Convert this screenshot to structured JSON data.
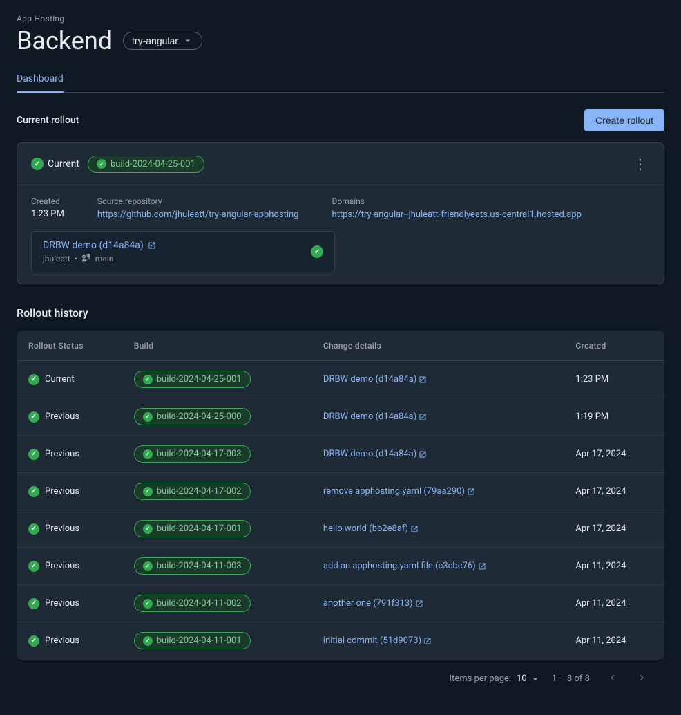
{
  "page": {
    "app_hosting_label": "App Hosting",
    "backend_title": "Backend",
    "branch_selector": "try-angular",
    "tab_dashboard": "Dashboard",
    "create_rollout_label": "Create rollout",
    "current_rollout_label": "Current rollout",
    "rollout_history_label": "Rollout history"
  },
  "current_rollout": {
    "status_label": "Current",
    "build_badge": "build-2024-04-25-001",
    "created_label": "Created",
    "created_value": "1:23 PM",
    "source_repo_label": "Source repository",
    "source_repo_url": "https://github.com/jhuleatt/try-angular-apphosting",
    "source_repo_display": "https://github.com/jhuleatt/try-angular-apphosting",
    "domains_label": "Domains",
    "domains_url": "https://try-angular--jhuleatt-friendlyeats.us-central1.hosted.app",
    "domains_display": "https://try-angular--jhuleatt-friendlyeats.us-central1.hosted.app",
    "commit_link_text": "DRBW demo (d14a84a)",
    "commit_user": "jhuleatt",
    "commit_branch": "main"
  },
  "table": {
    "col_status": "Rollout Status",
    "col_build": "Build",
    "col_change": "Change details",
    "col_created": "Created",
    "rows": [
      {
        "status": "Current",
        "build": "build-2024-04-25-001",
        "change": "DRBW demo (d14a84a)",
        "created": "1:23 PM"
      },
      {
        "status": "Previous",
        "build": "build-2024-04-25-000",
        "change": "DRBW demo (d14a84a)",
        "created": "1:19 PM"
      },
      {
        "status": "Previous",
        "build": "build-2024-04-17-003",
        "change": "DRBW demo (d14a84a)",
        "created": "Apr 17, 2024"
      },
      {
        "status": "Previous",
        "build": "build-2024-04-17-002",
        "change": "remove apphosting.yaml (79aa290)",
        "created": "Apr 17, 2024"
      },
      {
        "status": "Previous",
        "build": "build-2024-04-17-001",
        "change": "hello world (bb2e8af)",
        "created": "Apr 17, 2024"
      },
      {
        "status": "Previous",
        "build": "build-2024-04-11-003",
        "change": "add an apphosting.yaml file (c3cbc76)",
        "created": "Apr 11, 2024"
      },
      {
        "status": "Previous",
        "build": "build-2024-04-11-002",
        "change": "another one (791f313)",
        "created": "Apr 11, 2024"
      },
      {
        "status": "Previous",
        "build": "build-2024-04-11-001",
        "change": "initial commit (51d9073)",
        "created": "Apr 11, 2024"
      }
    ],
    "items_per_page_label": "Items per page:",
    "items_per_page_value": "10",
    "pagination_info": "1 – 8 of 8"
  }
}
